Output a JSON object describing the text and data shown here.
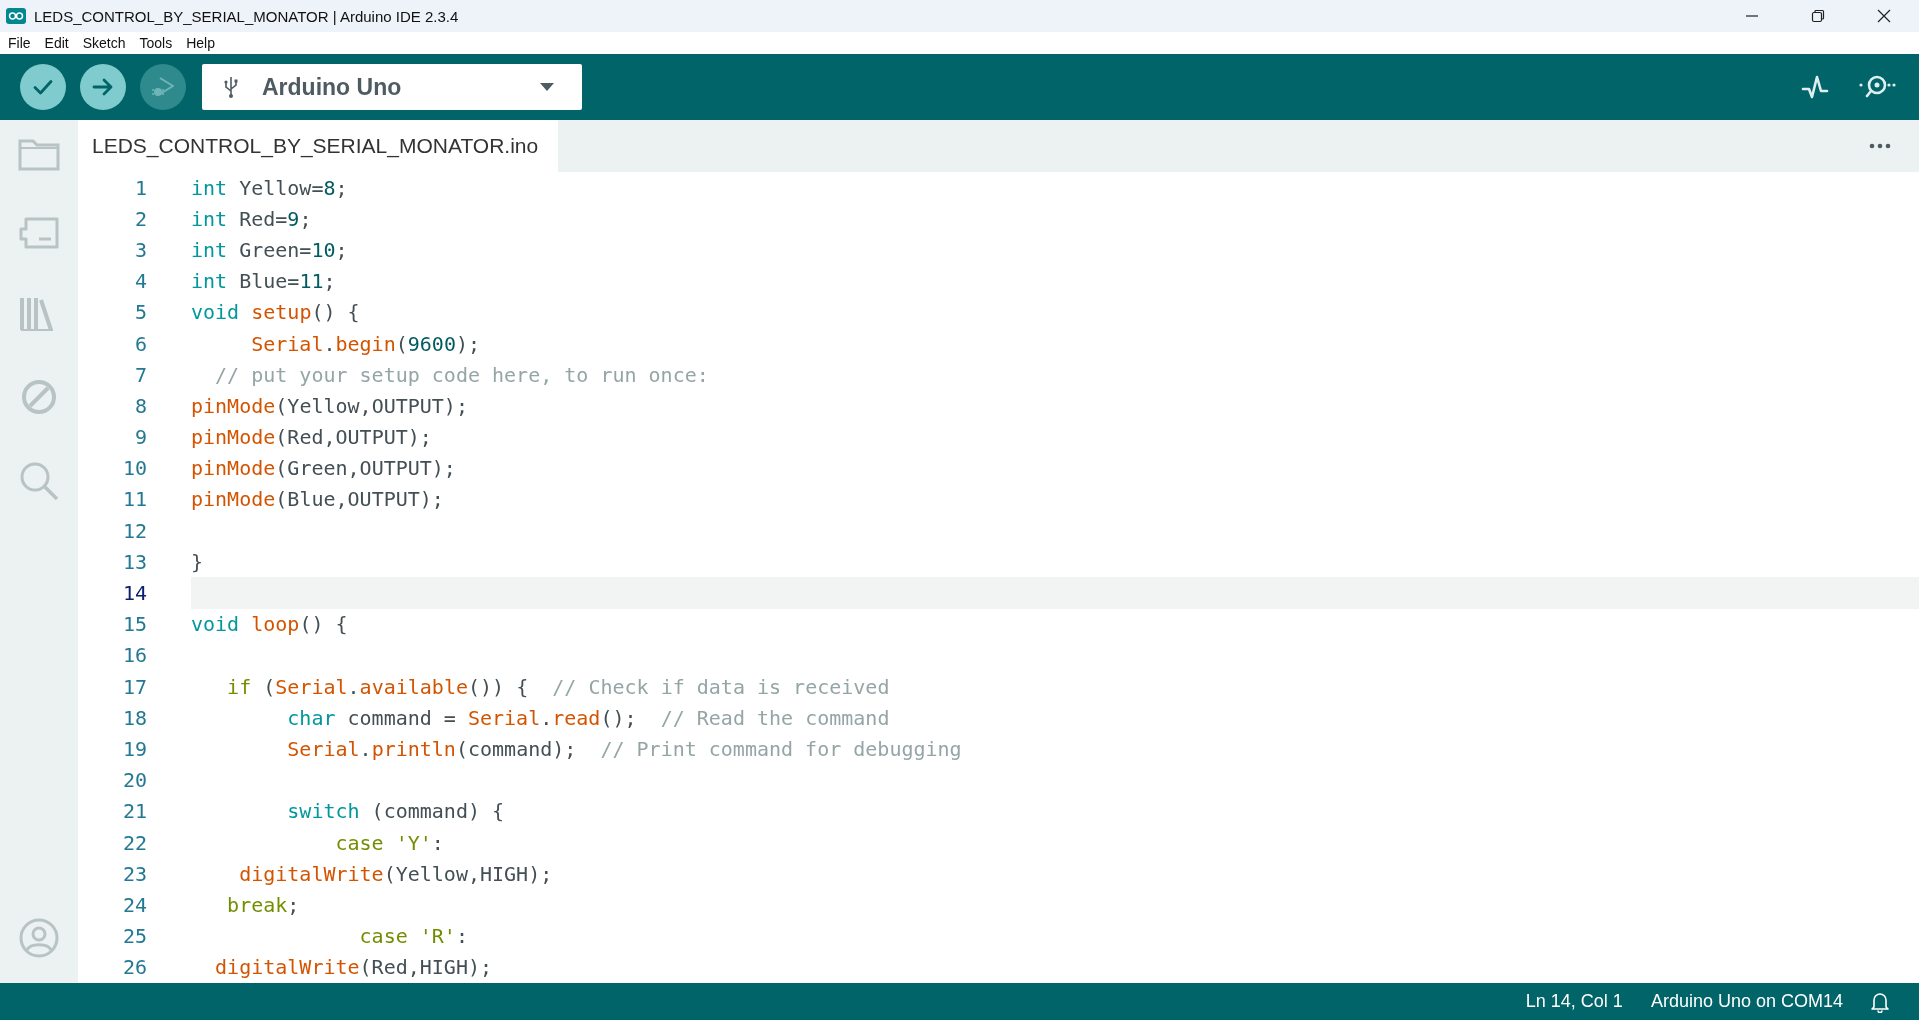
{
  "window": {
    "title": "LEDS_CONTROL_BY_SERIAL_MONATOR | Arduino IDE 2.3.4"
  },
  "menu": [
    "File",
    "Edit",
    "Sketch",
    "Tools",
    "Help"
  ],
  "toolbar": {
    "buttons": [
      {
        "kind": "verify",
        "disabled": false
      },
      {
        "kind": "upload",
        "disabled": false
      },
      {
        "kind": "debug",
        "disabled": true
      }
    ],
    "board": "Arduino Uno",
    "tools": [
      {
        "kind": "plotter"
      },
      {
        "kind": "monitor"
      }
    ]
  },
  "sidebar": {
    "items": [
      {
        "kind": "sketchbook"
      },
      {
        "kind": "boards"
      },
      {
        "kind": "library"
      },
      {
        "kind": "debug"
      },
      {
        "kind": "search"
      }
    ],
    "bottom": [
      {
        "kind": "profile"
      }
    ]
  },
  "tabs": [
    {
      "label": "LEDS_CONTROL_BY_SERIAL_MONATOR.ino",
      "selected": true
    }
  ],
  "editor": {
    "lines": [
      {
        "number": "1",
        "current": false,
        "tokens": [
          {
            "kind": "keyword",
            "t": "int"
          },
          {
            "kind": "plain",
            "t": " Yellow="
          },
          {
            "kind": "number",
            "t": "8"
          },
          {
            "kind": "plain",
            "t": ";"
          }
        ]
      },
      {
        "number": "2",
        "current": false,
        "tokens": [
          {
            "kind": "keyword",
            "t": "int"
          },
          {
            "kind": "plain",
            "t": " Red="
          },
          {
            "kind": "number",
            "t": "9"
          },
          {
            "kind": "plain",
            "t": ";"
          }
        ]
      },
      {
        "number": "3",
        "current": false,
        "tokens": [
          {
            "kind": "keyword",
            "t": "int"
          },
          {
            "kind": "plain",
            "t": " Green="
          },
          {
            "kind": "number",
            "t": "10"
          },
          {
            "kind": "plain",
            "t": ";"
          }
        ]
      },
      {
        "number": "4",
        "current": false,
        "tokens": [
          {
            "kind": "keyword",
            "t": "int"
          },
          {
            "kind": "plain",
            "t": " Blue="
          },
          {
            "kind": "number",
            "t": "11"
          },
          {
            "kind": "plain",
            "t": ";"
          }
        ]
      },
      {
        "number": "5",
        "current": false,
        "tokens": [
          {
            "kind": "keyword",
            "t": "void "
          },
          {
            "kind": "function",
            "t": "setup"
          },
          {
            "kind": "plain",
            "t": "() {"
          }
        ]
      },
      {
        "number": "6",
        "current": false,
        "tokens": [
          {
            "kind": "function",
            "t": "     Serial"
          },
          {
            "kind": "plain",
            "t": "."
          },
          {
            "kind": "function",
            "t": "begin"
          },
          {
            "kind": "plain",
            "t": "("
          },
          {
            "kind": "number",
            "t": "9600"
          },
          {
            "kind": "plain",
            "t": ");"
          }
        ]
      },
      {
        "number": "7",
        "current": false,
        "tokens": [
          {
            "kind": "comment",
            "t": "  // put your setup code here, to run once:"
          }
        ]
      },
      {
        "number": "8",
        "current": false,
        "tokens": [
          {
            "kind": "function",
            "t": "pinMode"
          },
          {
            "kind": "plain",
            "t": "(Yellow,OUTPUT);"
          }
        ]
      },
      {
        "number": "9",
        "current": false,
        "tokens": [
          {
            "kind": "function",
            "t": "pinMode"
          },
          {
            "kind": "plain",
            "t": "(Red,OUTPUT);"
          }
        ]
      },
      {
        "number": "10",
        "current": false,
        "tokens": [
          {
            "kind": "function",
            "t": "pinMode"
          },
          {
            "kind": "plain",
            "t": "(Green,OUTPUT);"
          }
        ]
      },
      {
        "number": "11",
        "current": false,
        "tokens": [
          {
            "kind": "function",
            "t": "pinMode"
          },
          {
            "kind": "plain",
            "t": "(Blue,OUTPUT);"
          }
        ]
      },
      {
        "number": "12",
        "current": false
      },
      {
        "number": "13",
        "current": false,
        "tokens": [
          {
            "kind": "plain",
            "t": "}"
          }
        ]
      },
      {
        "number": "14",
        "current": true
      },
      {
        "number": "15",
        "current": false,
        "tokens": [
          {
            "kind": "keyword",
            "t": "void "
          },
          {
            "kind": "function",
            "t": "loop"
          },
          {
            "kind": "plain",
            "t": "() {"
          }
        ]
      },
      {
        "number": "16",
        "current": false
      },
      {
        "number": "17",
        "current": false,
        "tokens": [
          {
            "kind": "control",
            "t": "   if"
          },
          {
            "kind": "plain",
            "t": " ("
          },
          {
            "kind": "function",
            "t": "Serial"
          },
          {
            "kind": "plain",
            "t": "."
          },
          {
            "kind": "function",
            "t": "available"
          },
          {
            "kind": "plain",
            "t": "()) {  "
          },
          {
            "kind": "comment",
            "t": "// Check if data is received"
          }
        ]
      },
      {
        "number": "18",
        "current": false,
        "tokens": [
          {
            "kind": "keyword",
            "t": "        char"
          },
          {
            "kind": "plain",
            "t": " command = "
          },
          {
            "kind": "function",
            "t": "Serial"
          },
          {
            "kind": "plain",
            "t": "."
          },
          {
            "kind": "function",
            "t": "read"
          },
          {
            "kind": "plain",
            "t": "();  "
          },
          {
            "kind": "comment",
            "t": "// Read the command"
          }
        ]
      },
      {
        "number": "19",
        "current": false,
        "tokens": [
          {
            "kind": "function",
            "t": "        Serial"
          },
          {
            "kind": "plain",
            "t": "."
          },
          {
            "kind": "function",
            "t": "println"
          },
          {
            "kind": "plain",
            "t": "(command);  "
          },
          {
            "kind": "comment",
            "t": "// Print command for debugging"
          }
        ]
      },
      {
        "number": "20",
        "current": false
      },
      {
        "number": "21",
        "current": false,
        "tokens": [
          {
            "kind": "keyword",
            "t": "        switch"
          },
          {
            "kind": "plain",
            "t": " (command) {"
          }
        ]
      },
      {
        "number": "22",
        "current": false,
        "tokens": [
          {
            "kind": "control",
            "t": "            case "
          },
          {
            "kind": "string",
            "t": "'Y'"
          },
          {
            "kind": "plain",
            "t": ":"
          }
        ]
      },
      {
        "number": "23",
        "current": false,
        "tokens": [
          {
            "kind": "function",
            "t": "    digitalWrite"
          },
          {
            "kind": "plain",
            "t": "(Yellow,HIGH);"
          }
        ]
      },
      {
        "number": "24",
        "current": false,
        "tokens": [
          {
            "kind": "control",
            "t": "   break"
          },
          {
            "kind": "plain",
            "t": ";"
          }
        ]
      },
      {
        "number": "25",
        "current": false,
        "tokens": [
          {
            "kind": "control",
            "t": "              case "
          },
          {
            "kind": "string",
            "t": "'R'"
          },
          {
            "kind": "plain",
            "t": ":"
          }
        ]
      },
      {
        "number": "26",
        "current": false,
        "tokens": [
          {
            "kind": "function",
            "t": "  digitalWrite"
          },
          {
            "kind": "plain",
            "t": "(Red,HIGH);"
          }
        ]
      }
    ]
  },
  "status_bar": {
    "position": "Ln 14, Col 1",
    "board": "Arduino Uno on COM14"
  }
}
